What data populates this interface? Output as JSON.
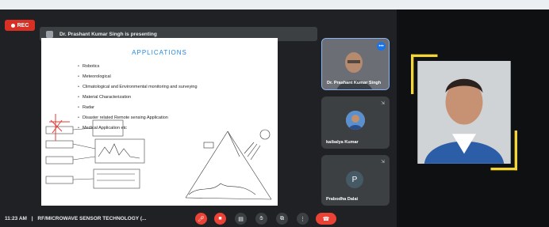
{
  "recording": {
    "label": "REC"
  },
  "presenter": {
    "name": "Dr. Prashant Kumar Singh",
    "suffix": "is presenting"
  },
  "slide": {
    "title": "APPLICATIONS",
    "bullets": [
      "Robotics",
      "Meteorological",
      "Climatological and Environmental monitoring and surveying",
      "Material Characterization",
      "Radar",
      "Disaster related Remote sensing Application",
      "Medical Application etc"
    ]
  },
  "participants": [
    {
      "name": "Dr. Prashant Kumar Singh"
    },
    {
      "name": "kaibalya Kumar"
    },
    {
      "name": "Prabodha Dalai",
      "initial": "P"
    }
  ],
  "toolbar": {
    "time": "11:23 AM",
    "separator": "|",
    "meeting_title": "RF/MICROWAVE SENSOR TECHNOLOGY (..."
  },
  "colors": {
    "accent_frame": "#f5d53c",
    "meet_bg": "#202124",
    "end_call": "#ea4335",
    "rec": "#d93025"
  }
}
